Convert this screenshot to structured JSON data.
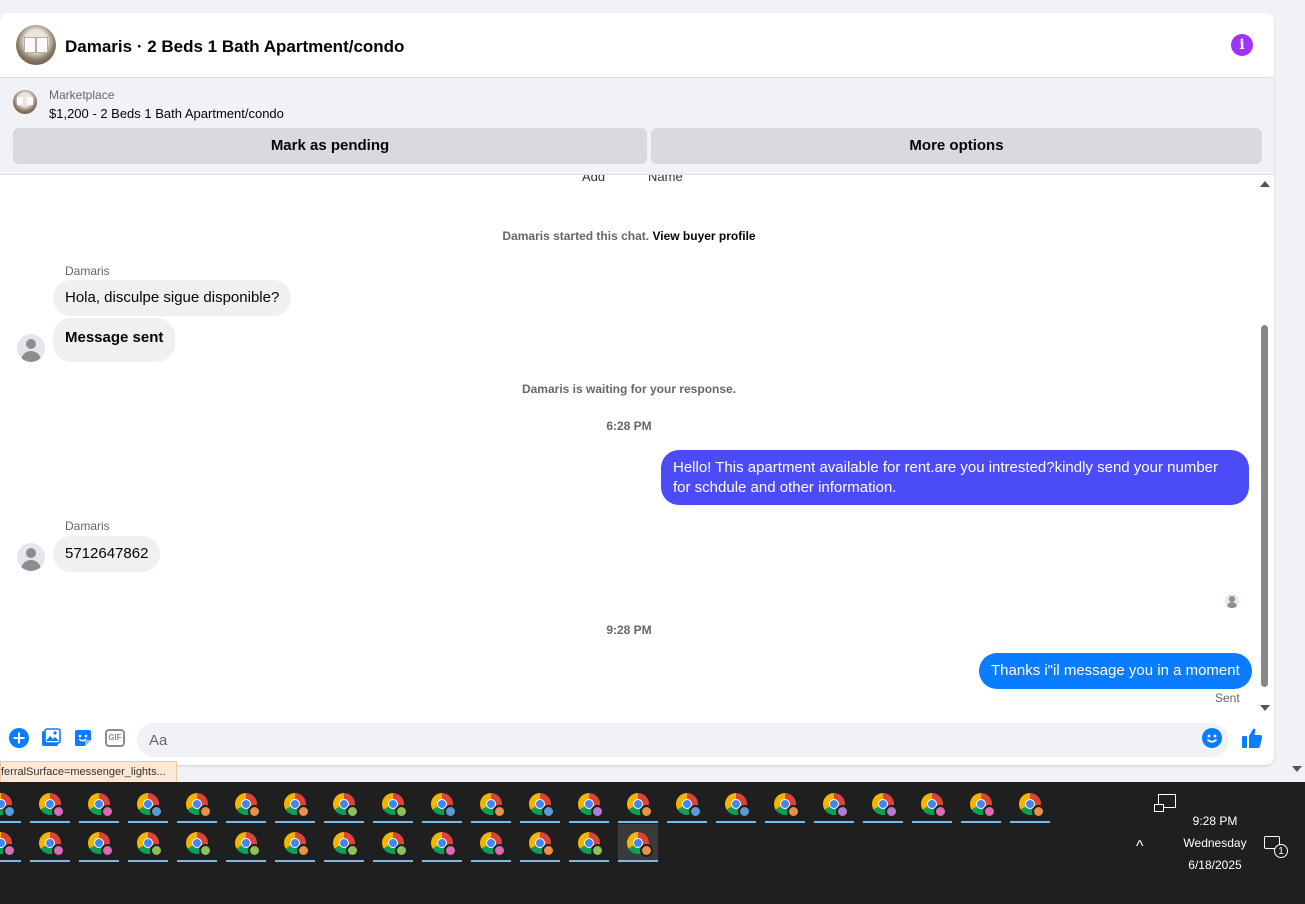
{
  "header": {
    "title": "Damaris · 2 Beds 1 Bath Apartment/condo",
    "info_icon": "info-icon",
    "info_glyph": "i",
    "accent": "#a033ff"
  },
  "listing": {
    "marketplace_label": "Marketplace",
    "price_title": "$1,200 - 2 Beds 1 Bath Apartment/condo",
    "mark_pending": "Mark as pending",
    "more_options": "More options"
  },
  "messages": {
    "partial_left": "Add",
    "partial_right": "Name",
    "started_chat": "Damaris started this chat.",
    "view_profile": "View buyer profile",
    "sender_name_1": "Damaris",
    "msg_1": "Hola, disculpe sigue disponible?",
    "msg_2": "Message sent",
    "waiting": "Damaris is waiting for your response.",
    "time_1": "6:28 PM",
    "msg_3_line_1": "Hello! This apartment available for rent.are you intrested?kindly send your number",
    "msg_3_line_2": "for schdule and other information.",
    "sender_name_2": "Damaris",
    "msg_4": "5712647862",
    "time_2": "9:28 PM",
    "msg_5": "Thanks i\"il message you in a moment",
    "status": "Sent",
    "outgoing_color_1": "#4b4bf7",
    "outgoing_color_2": "#0a7cff"
  },
  "composer": {
    "placeholder": "Aa",
    "icons": [
      "plus-circle-icon",
      "photo-icon",
      "sticker-icon",
      "gif-icon",
      "emoji-icon",
      "thumbs-up-icon"
    ],
    "gif_label": "GIF",
    "accent": "#0a7cff"
  },
  "status_bar": {
    "url": "ferralSurface=messenger_lights..."
  },
  "taskbar": {
    "row1_badges": [
      "#5b9bd5",
      "#d96bb5",
      "#d96bb5",
      "#5b9bd5",
      "#e8914a",
      "#e8914a",
      "#e8914a",
      "#8fbf5a",
      "#8fbf5a",
      "#5b9bd5",
      "#e8914a",
      "#5b9bd5",
      "#b37bd9",
      "#e8914a",
      "#5b9bd5",
      "#5b9bd5",
      "#e8914a",
      "#b37bd9",
      "#b37bd9",
      "#d96bb5",
      "#d96bb5",
      "#e8914a"
    ],
    "row2_badges": [
      "#d96bb5",
      "#d96bb5",
      "#d96bb5",
      "#8fbf5a",
      "#8fbf5a",
      "#8fbf5a",
      "#e8914a",
      "#8fbf5a",
      "#8fbf5a",
      "#d96bb5",
      "#d96bb5",
      "#e8914a",
      "#8fbf5a",
      "#e8914a"
    ],
    "time": "9:28 PM",
    "day": "Wednesday",
    "date": "6/18/2025",
    "notification_count": "1",
    "tray_chevron": "^"
  }
}
